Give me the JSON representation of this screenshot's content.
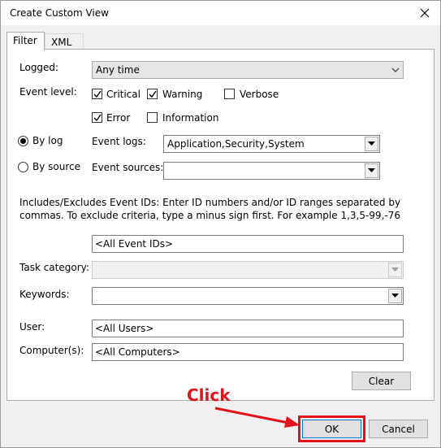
{
  "window": {
    "title": "Create Custom View"
  },
  "tabs": [
    {
      "label": "Filter"
    },
    {
      "label": "XML"
    }
  ],
  "filter": {
    "logged_label": "Logged:",
    "logged_value": "Any time",
    "event_level_label": "Event level:",
    "levels": {
      "critical": {
        "label": "Critical",
        "checked": true
      },
      "warning": {
        "label": "Warning",
        "checked": true
      },
      "verbose": {
        "label": "Verbose",
        "checked": false
      },
      "error": {
        "label": "Error",
        "checked": true
      },
      "information": {
        "label": "Information",
        "checked": false
      }
    },
    "by_log_label": "By log",
    "by_source_label": "By source",
    "event_logs_label": "Event logs:",
    "event_logs_value": "Application,Security,System",
    "event_sources_label": "Event sources:",
    "event_sources_value": "",
    "ids_description": "Includes/Excludes Event IDs: Enter ID numbers and/or ID ranges separated by commas. To exclude criteria, type a minus sign first. For example 1,3,5-99,-76",
    "event_ids_value": "<All Event IDs>",
    "task_category_label": "Task category:",
    "keywords_label": "Keywords:",
    "user_label": "User:",
    "user_value": "<All Users>",
    "computer_label": "Computer(s):",
    "computer_value": "<All Computers>",
    "clear_label": "Clear"
  },
  "buttons": {
    "ok": "OK",
    "cancel": "Cancel"
  },
  "annotation": {
    "text": "Click",
    "color": "#e2121a"
  }
}
